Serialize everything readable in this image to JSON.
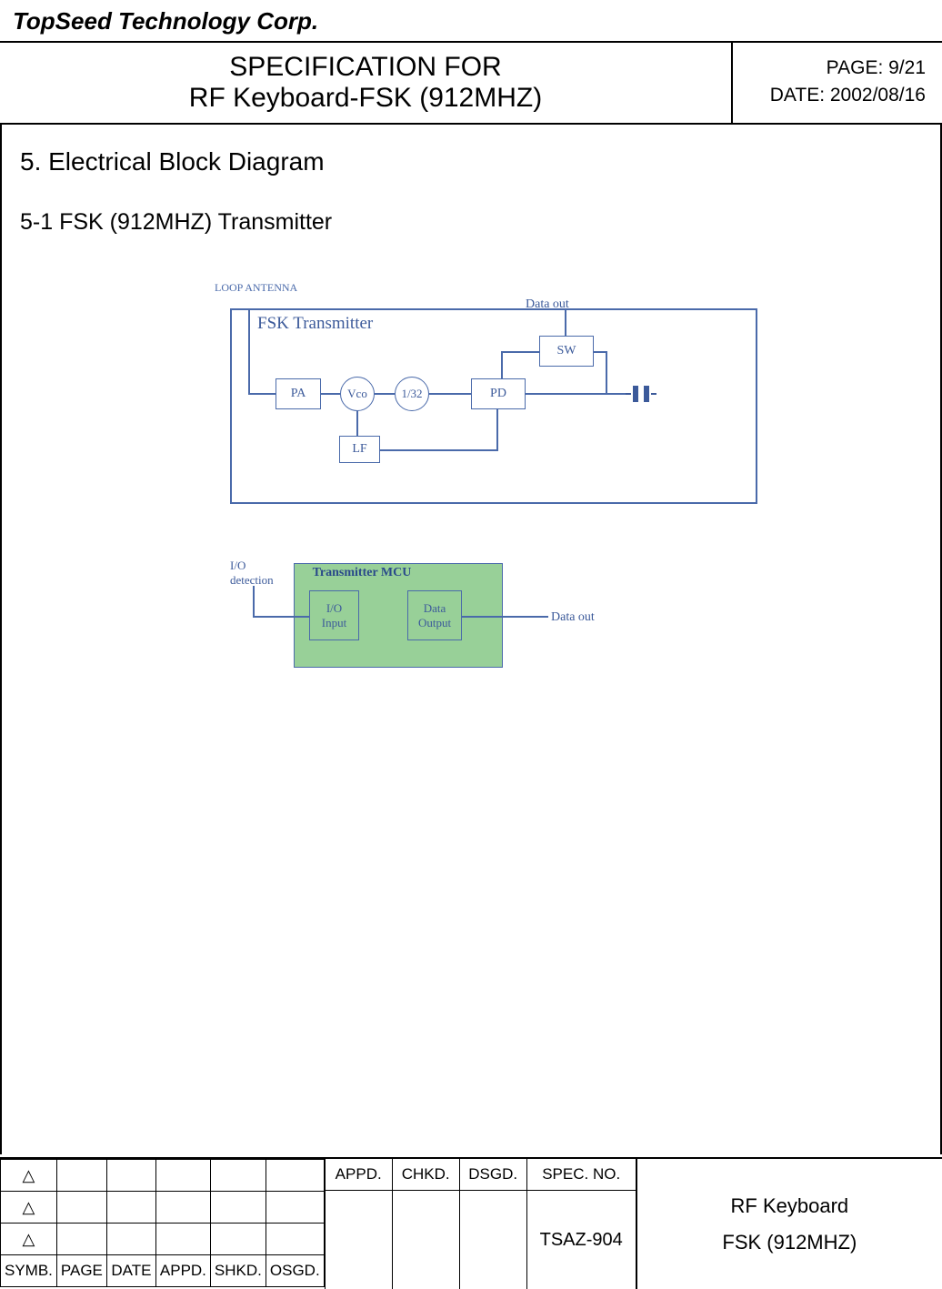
{
  "company": "TopSeed Technology Corp.",
  "title": {
    "line1": "SPECIFICATION FOR",
    "line2": "RF Keyboard-FSK (912MHZ)"
  },
  "header_right": {
    "page": "PAGE: 9/21",
    "date": "DATE: 2002/08/16"
  },
  "section_title": "5. Electrical Block Diagram",
  "subsection_title": "5-1 FSK (912MHZ) Transmitter",
  "diagram": {
    "loop_antenna": "LOOP ANTENNA",
    "fsk_label": "FSK Transmitter",
    "data_out_top": "Data out",
    "pa": "PA",
    "vco": "Vco",
    "div32": "1/32",
    "pd": "PD",
    "sw": "SW",
    "lf": "LF",
    "mcu_title": "Transmitter MCU",
    "io_input_line1": "I/O",
    "io_input_line2": "Input",
    "data_output_line1": "Data",
    "data_output_line2": "Output",
    "io_det_line1": "I/O",
    "io_det_line2": "detection",
    "data_out_right": "Data out"
  },
  "footer": {
    "left_headers": [
      "SYMB.",
      "PAGE",
      "DATE",
      "APPD.",
      "SHKD.",
      "OSGD."
    ],
    "mid_headers": {
      "appd": "APPD.",
      "chkd": "CHKD.",
      "dsgd": "DSGD.",
      "spec_no": "SPEC. NO."
    },
    "spec_value": "TSAZ-904",
    "right_line1": "RF Keyboard",
    "right_line2": "FSK (912MHZ)"
  }
}
